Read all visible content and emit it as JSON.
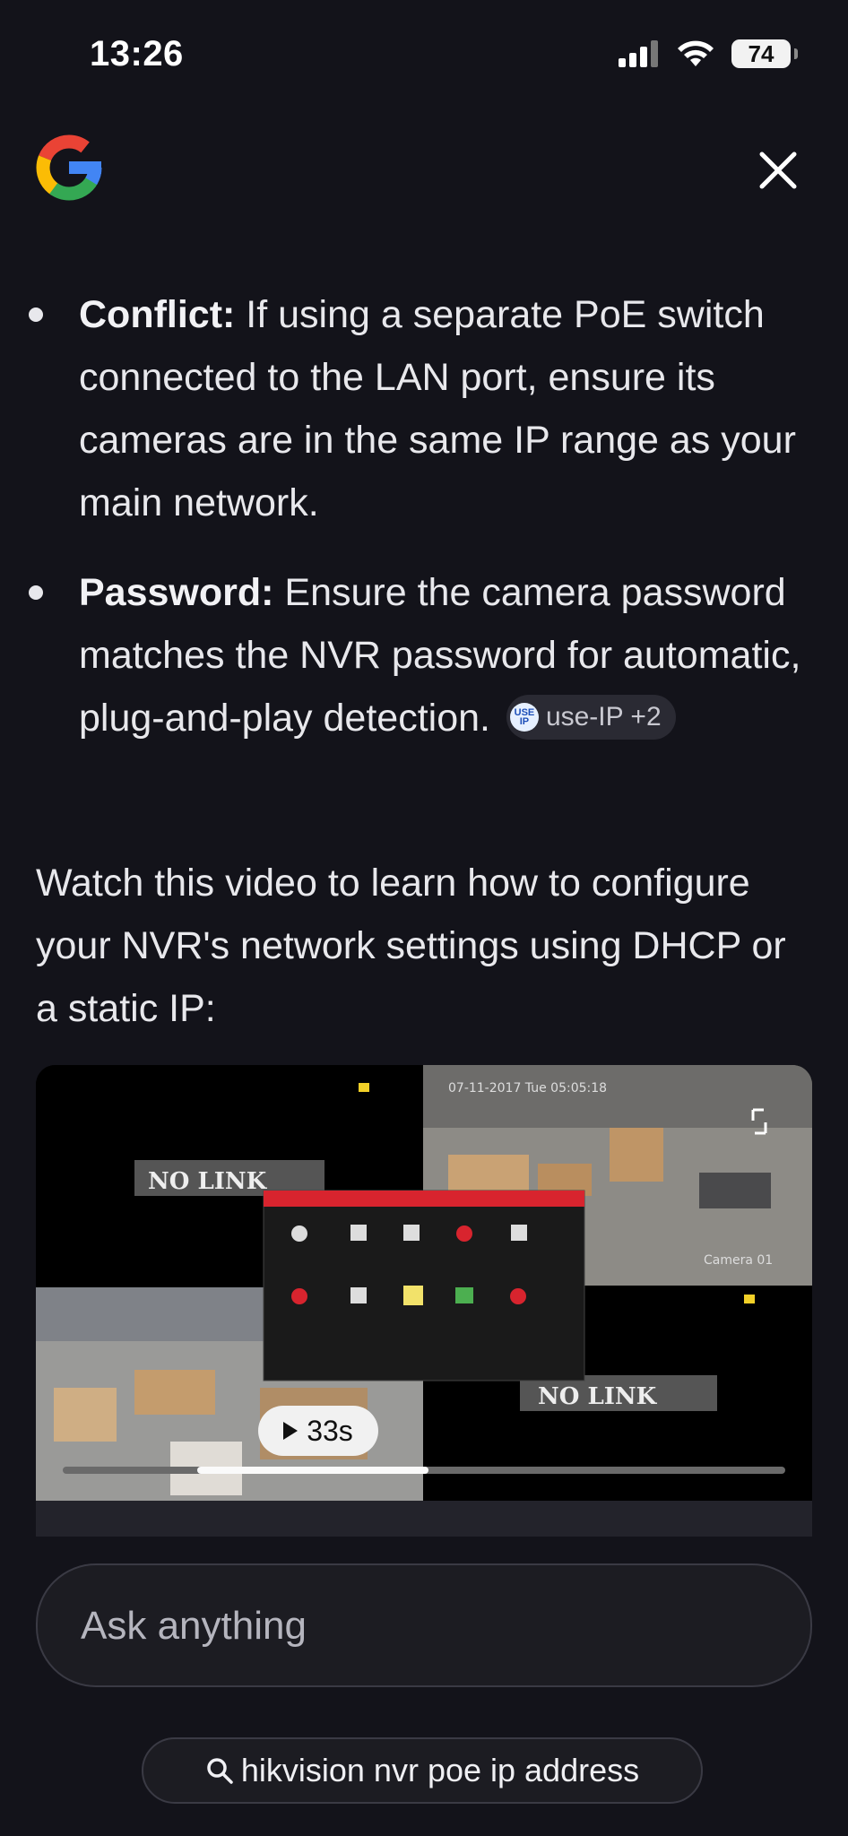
{
  "status_bar": {
    "time": "13:26",
    "battery": "74"
  },
  "header": {
    "logo_icon": "google-g-icon",
    "close_icon": "close-icon"
  },
  "bullets": [
    {
      "bold": "Conflict:",
      "text": " If using a separate PoE switch connected to the LAN port, ensure its cameras are in the same IP range as your main network."
    },
    {
      "bold": "Password:",
      "text": " Ensure the camera password matches the NVR password for automatic, plug-and-play detection.",
      "chip": {
        "icon_text": "USE IP",
        "label": "use-IP +2"
      }
    }
  ],
  "intro_text": "Watch this video to learn how to configure your NVR's network settings using DHCP or a static IP:",
  "video": {
    "duration": "33s",
    "progress": 0.32,
    "overlay_text": {
      "no_link": "NO LINK",
      "camera_timestamp": "07-11-2017 Tue 05:05:18",
      "camera_label": "Camera 01"
    }
  },
  "ask": {
    "placeholder": "Ask anything"
  },
  "suggestion": {
    "label": "hikvision nvr poe ip address"
  },
  "colors": {
    "background": "#13131a",
    "text": "#e8e8ec",
    "chip_bg": "#2a2a33"
  }
}
